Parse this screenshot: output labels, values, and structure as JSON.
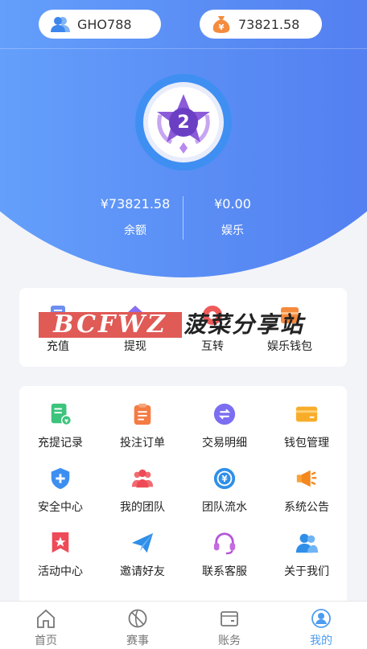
{
  "header": {
    "username": "GHO788",
    "balance": "73821.58"
  },
  "badge": {
    "level": "2"
  },
  "stats": {
    "main_balance": "¥73821.58",
    "main_label": "余额",
    "game_balance": "¥0.00",
    "game_label": "娱乐"
  },
  "actions": [
    {
      "label": "充值",
      "icon": "deposit-icon"
    },
    {
      "label": "提现",
      "icon": "withdraw-icon"
    },
    {
      "label": "互转",
      "icon": "transfer-icon"
    },
    {
      "label": "娱乐钱包",
      "icon": "game-wallet-icon"
    }
  ],
  "watermark": {
    "en": "BCFWZ",
    "cn": "菠菜分享站"
  },
  "menu": [
    {
      "label": "充提记录",
      "icon": "records-icon"
    },
    {
      "label": "投注订单",
      "icon": "bet-orders-icon"
    },
    {
      "label": "交易明细",
      "icon": "transactions-icon"
    },
    {
      "label": "钱包管理",
      "icon": "wallet-icon"
    },
    {
      "label": "安全中心",
      "icon": "shield-icon"
    },
    {
      "label": "我的团队",
      "icon": "team-icon"
    },
    {
      "label": "团队流水",
      "icon": "team-flow-icon"
    },
    {
      "label": "系统公告",
      "icon": "megaphone-icon"
    },
    {
      "label": "活动中心",
      "icon": "event-icon"
    },
    {
      "label": "邀请好友",
      "icon": "paper-plane-icon"
    },
    {
      "label": "联系客服",
      "icon": "headset-icon"
    },
    {
      "label": "关于我们",
      "icon": "about-icon"
    }
  ],
  "tabs": [
    {
      "label": "首页",
      "icon": "home-icon",
      "active": false
    },
    {
      "label": "赛事",
      "icon": "ball-icon",
      "active": false
    },
    {
      "label": "账务",
      "icon": "wallet-tab-icon",
      "active": false
    },
    {
      "label": "我的",
      "icon": "profile-icon",
      "active": true
    }
  ],
  "colors": {
    "primary": "#5b8ff5",
    "active_tab": "#4d9cf2"
  }
}
